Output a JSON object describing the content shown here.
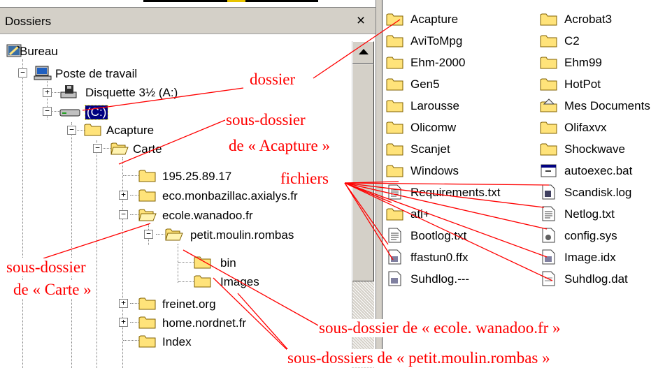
{
  "folders_pane": {
    "title": "Dossiers",
    "close_glyph": "×",
    "tree": [
      {
        "label": "Bureau",
        "icon": "desktop-icon"
      },
      {
        "label": "Poste de travail",
        "icon": "computer-icon",
        "expander": "−"
      },
      {
        "label": "Disquette 3½ (A:)",
        "icon": "floppy-drive-icon",
        "expander": "+"
      },
      {
        "label": "(C:)",
        "icon": "hard-drive-icon",
        "expander": "−",
        "selected": true
      },
      {
        "label": "Acapture",
        "icon": "folder-icon",
        "expander": "−"
      },
      {
        "label": "Carte",
        "icon": "open-folder-icon",
        "expander": "−"
      },
      {
        "label": "195.25.89.17",
        "icon": "folder-icon"
      },
      {
        "label": "eco.monbazillac.axialys.fr",
        "icon": "folder-icon",
        "expander": "+"
      },
      {
        "label": "ecole.wanadoo.fr",
        "icon": "open-folder-icon",
        "expander": "−"
      },
      {
        "label": "petit.moulin.rombas",
        "icon": "open-folder-icon",
        "expander": "−"
      },
      {
        "label": "bin",
        "icon": "folder-icon"
      },
      {
        "label": "Images",
        "icon": "folder-icon"
      },
      {
        "label": "freinet.org",
        "icon": "folder-icon",
        "expander": "+"
      },
      {
        "label": "home.nordnet.fr",
        "icon": "folder-icon",
        "expander": "+"
      },
      {
        "label": "Index",
        "icon": "folder-icon"
      }
    ]
  },
  "files_pane": {
    "column1": [
      {
        "label": "Acapture",
        "icon": "folder-icon"
      },
      {
        "label": "AviToMpg",
        "icon": "folder-icon"
      },
      {
        "label": "Ehm-2000",
        "icon": "folder-icon"
      },
      {
        "label": "Gen5",
        "icon": "folder-icon"
      },
      {
        "label": "Larousse",
        "icon": "folder-icon"
      },
      {
        "label": "Olicomw",
        "icon": "folder-icon"
      },
      {
        "label": "Scanjet",
        "icon": "folder-icon"
      },
      {
        "label": "Windows",
        "icon": "folder-icon"
      },
      {
        "label": "Requirements.txt",
        "icon": "text-file-icon"
      },
      {
        "label": "ati+",
        "icon": "folder-icon"
      },
      {
        "label": "Bootlog.txt",
        "icon": "text-file-icon"
      },
      {
        "label": "ffastun0.ffx",
        "icon": "system-file-icon"
      },
      {
        "label": "Suhdlog.---",
        "icon": "system-file-icon"
      }
    ],
    "column2": [
      {
        "label": "Acrobat3",
        "icon": "folder-icon"
      },
      {
        "label": "C2",
        "icon": "folder-icon"
      },
      {
        "label": "Ehm99",
        "icon": "folder-icon"
      },
      {
        "label": "HotPot",
        "icon": "folder-icon"
      },
      {
        "label": "Mes Documents",
        "icon": "my-documents-icon"
      },
      {
        "label": "Olifaxvx",
        "icon": "folder-icon"
      },
      {
        "label": "Shockwave",
        "icon": "folder-icon"
      },
      {
        "label": "autoexec.bat",
        "icon": "batch-file-icon"
      },
      {
        "label": "Scandisk.log",
        "icon": "log-file-icon"
      },
      {
        "label": "Netlog.txt",
        "icon": "text-file-icon"
      },
      {
        "label": "config.sys",
        "icon": "config-file-icon"
      },
      {
        "label": "Image.idx",
        "icon": "system-file-icon"
      },
      {
        "label": "Suhdlog.dat",
        "icon": "data-file-icon"
      }
    ]
  },
  "annotations": {
    "dossier": "dossier",
    "sous_dossier_1": "sous-dossier",
    "de_acapture": "de « Acapture »",
    "fichiers": "fichiers",
    "sous_dossier_2": "sous-dossier",
    "de_carte": "de « Carte »",
    "sous_dossier_ecole": "sous-dossier de « ecole. wanadoo.fr »",
    "sous_dossiers_petit": "sous-dossiers de « petit.moulin.rombas »"
  },
  "colors": {
    "annotation": "#ff0000",
    "folder": "#ffe37a",
    "selection": "#000080",
    "chrome": "#d4d0c8"
  }
}
